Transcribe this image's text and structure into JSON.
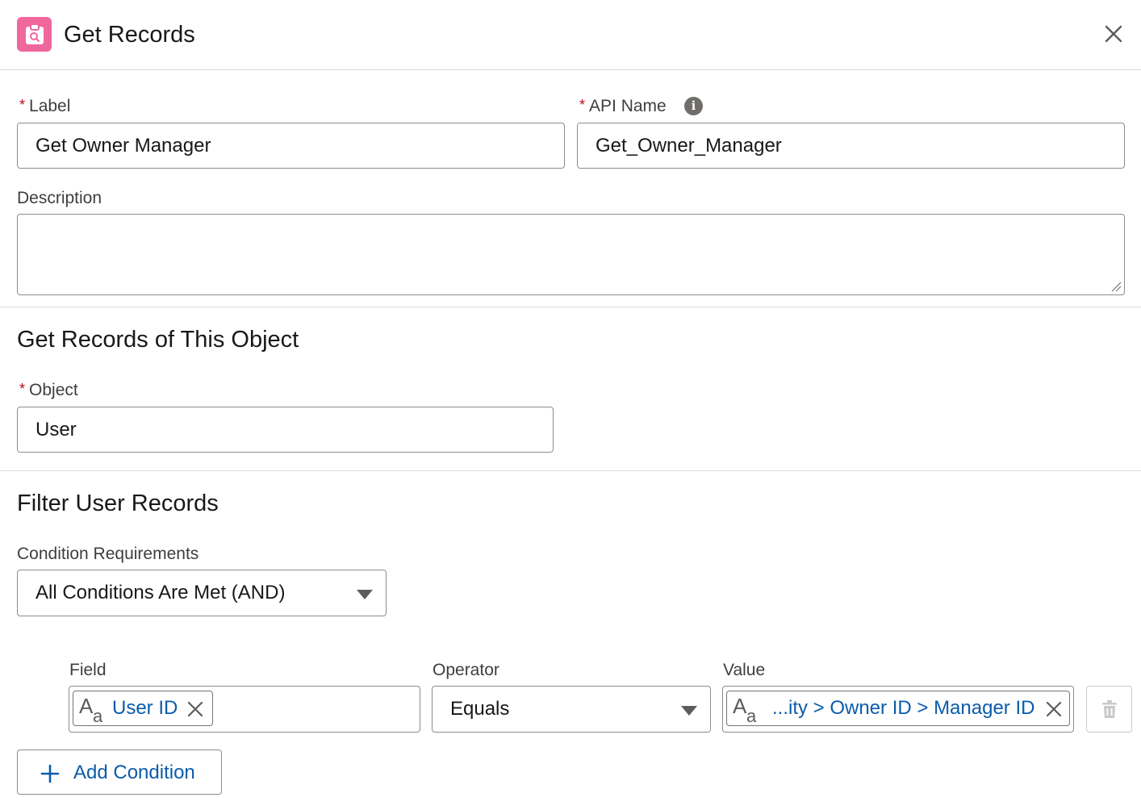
{
  "header": {
    "title": "Get Records",
    "icon": "get-records-icon",
    "icon_color": "#f0679e",
    "close_icon": "close-icon"
  },
  "form": {
    "required_marker": "*",
    "label": {
      "label": "Label",
      "value": "Get Owner Manager"
    },
    "api_name": {
      "label": "API Name",
      "value": "Get_Owner_Manager",
      "info_icon": "info-icon"
    },
    "description": {
      "label": "Description",
      "value": ""
    }
  },
  "object_section": {
    "title": "Get Records of This Object",
    "object": {
      "label": "Object",
      "value": "User"
    }
  },
  "filter_section": {
    "title": "Filter User Records",
    "condition_requirements": {
      "label": "Condition Requirements",
      "selected": "All Conditions Are Met (AND)"
    },
    "conditions": [
      {
        "field_label": "Field",
        "field_value": "User ID",
        "operator_label": "Operator",
        "operator_value": "Equals",
        "value_label": "Value",
        "value_value": "...ity > Owner ID > Manager ID"
      }
    ],
    "add_condition_label": "Add Condition"
  },
  "colors": {
    "accent": "#0b5cab",
    "required": "#ba0517",
    "brand_icon": "#f0679e"
  }
}
